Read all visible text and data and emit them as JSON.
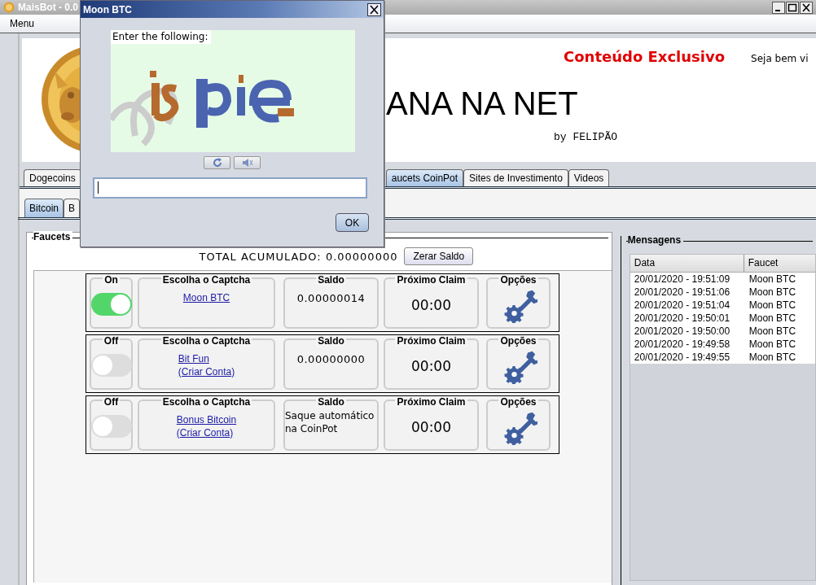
{
  "main_window": {
    "title": "MaisBot - 0.0",
    "menu": [
      "Menu"
    ]
  },
  "header": {
    "highlight": "Conteúdo Exclusivo",
    "welcome": "Seja bem vi",
    "headline": "ANA NA NET",
    "byline": "by FELIPÃO"
  },
  "tabs": [
    {
      "label": "Dogecoins",
      "selected": false
    },
    {
      "label": "aucets CoinPot",
      "selected": true
    },
    {
      "label": "Sites de Investimento",
      "selected": false
    },
    {
      "label": "Videos",
      "selected": false
    }
  ],
  "subtabs": [
    {
      "label": "Bitcoin",
      "selected": true
    },
    {
      "label": "B",
      "selected": false
    }
  ],
  "faucets": {
    "title": "Faucets",
    "total": "TOTAL ACUMULADO: 0.00000000",
    "reset_button": "Zerar Saldo",
    "rows": [
      {
        "on": true,
        "toggle_label": "On",
        "captcha_heading": "Escolha o Captcha",
        "links": [
          "Moon BTC"
        ],
        "saldo_heading": "Saldo",
        "saldo": "0.00000014",
        "claim_heading": "Próximo Claim",
        "claim": "00:00",
        "options_heading": "Opções"
      },
      {
        "on": false,
        "toggle_label": "Off",
        "captcha_heading": "Escolha o Captcha",
        "links": [
          "Bit Fun",
          "(Criar Conta)"
        ],
        "saldo_heading": "Saldo",
        "saldo": "0.00000000",
        "claim_heading": "Próximo Claim",
        "claim": "00:00",
        "options_heading": "Opções"
      },
      {
        "on": false,
        "toggle_label": "Off",
        "captcha_heading": "Escolha o Captcha",
        "links": [
          "Bonus Bitcoin",
          "(Criar Conta)"
        ],
        "saldo_heading": "Saldo",
        "saldo": "Saque automático na CoinPot",
        "claim_heading": "Próximo Claim",
        "claim": "00:00",
        "options_heading": "Opções"
      }
    ]
  },
  "messages": {
    "title": "Mensagens",
    "columns": [
      "Data",
      "Faucet"
    ],
    "rows": [
      [
        "20/01/2020 - 19:51:09",
        "Moon BTC"
      ],
      [
        "20/01/2020 - 19:51:06",
        "Moon BTC"
      ],
      [
        "20/01/2020 - 19:51:04",
        "Moon BTC"
      ],
      [
        "20/01/2020 - 19:50:01",
        "Moon BTC"
      ],
      [
        "20/01/2020 - 19:50:00",
        "Moon BTC"
      ],
      [
        "20/01/2020 - 19:49:58",
        "Moon BTC"
      ],
      [
        "20/01/2020 - 19:49:55",
        "Moon BTC"
      ]
    ]
  },
  "dialog": {
    "title": "Moon BTC",
    "prompt": "Enter the following:",
    "ok": "OK"
  }
}
